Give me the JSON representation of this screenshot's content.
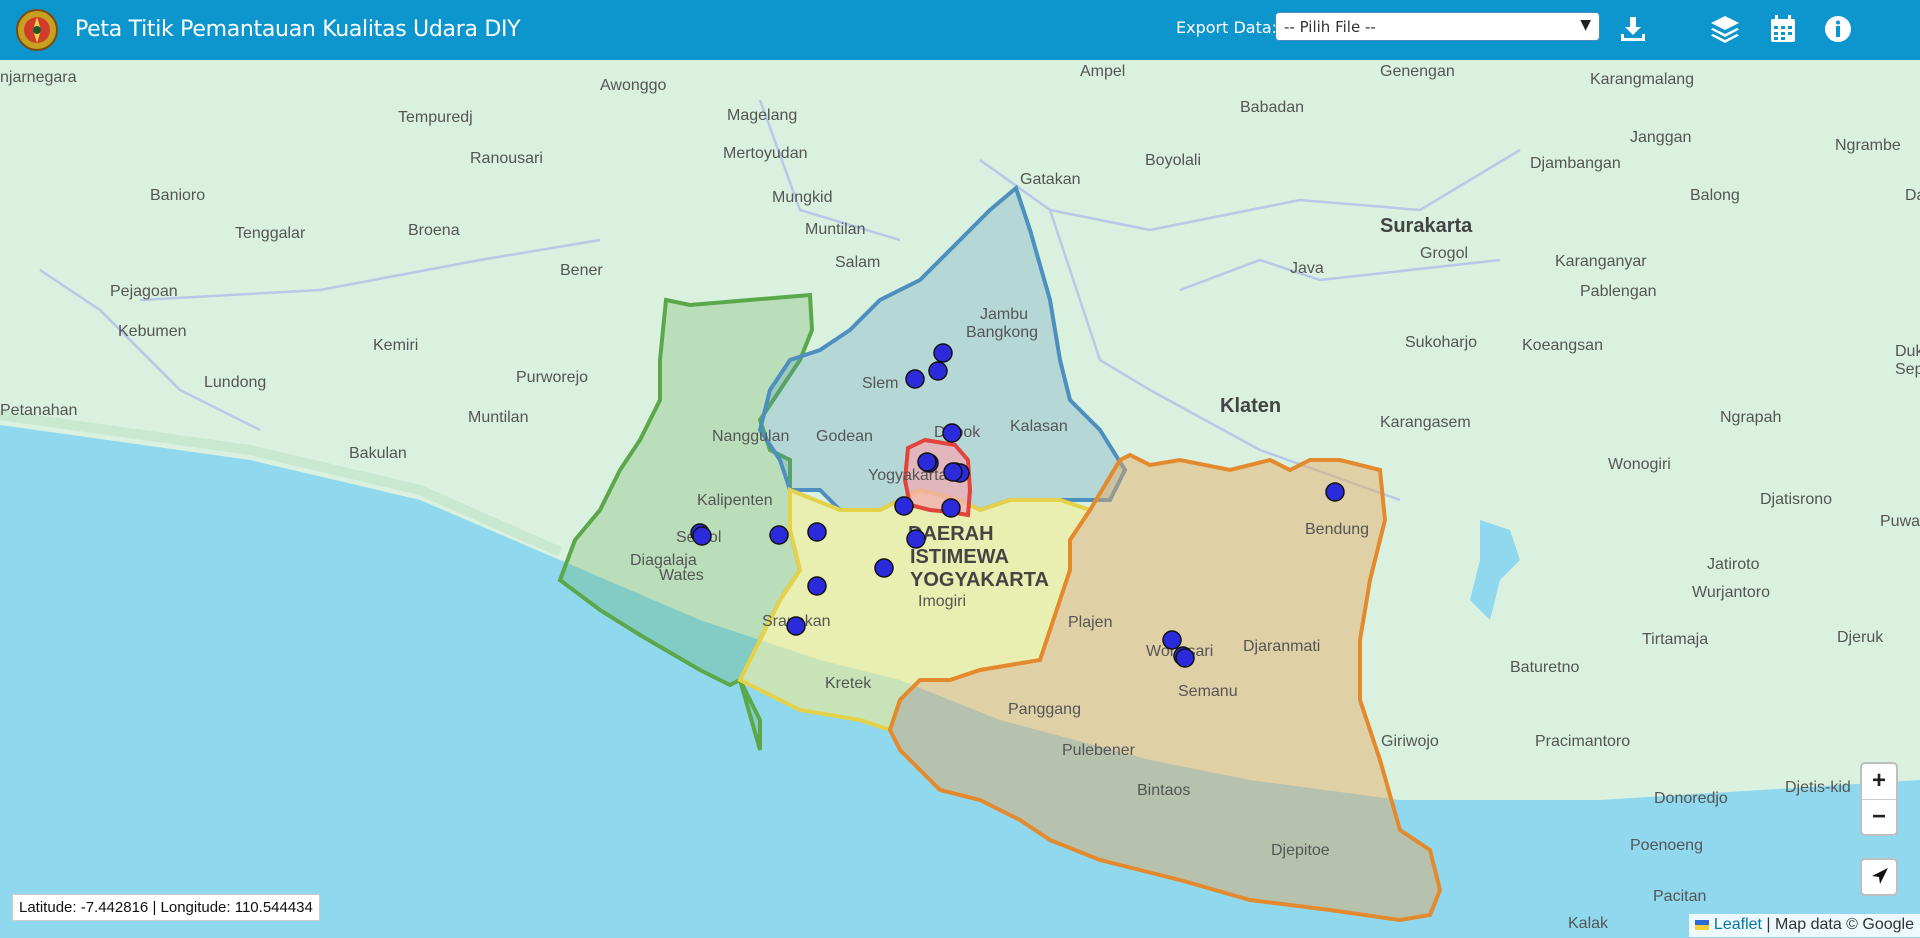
{
  "header": {
    "title": "Peta Titik Pemantauan Kualitas Udara DIY",
    "export_label": "Export Data:",
    "export_select_value": "-- Pilih File --",
    "background": "#0d96cd"
  },
  "toolbar": {
    "download_icon": "download-icon",
    "layers_icon": "layers-icon",
    "calendar_icon": "calendar-icon",
    "info_icon": "info-icon"
  },
  "map": {
    "coordinate_readout": "Latitude: -7.442816 | Longitude: 110.544434",
    "attribution_leaflet": "Leaflet",
    "attribution_rest": " | Map data © Google",
    "zoom_in": "+",
    "zoom_out": "−",
    "colors": {
      "sea": "#8fd8ee",
      "land": "#d6f0dc",
      "sleman": "#4d8fbf",
      "kulonprogo": "#5aa84a",
      "bantul": "#e6d24a",
      "gunungkidul": "#e38a2e",
      "kota": "#e0443c",
      "station": "#2b2bdc"
    },
    "place_labels": [
      "njarnegara",
      "Awonggo",
      "Ampel",
      "Genengan",
      "Karangmalang",
      "Tempuredj",
      "Magelang",
      "Babadan",
      "Ranousari",
      "Mertoyudan",
      "Boyolali",
      "Janggan",
      "Ngrambe",
      "Banioro",
      "Mungkid",
      "Gatakan",
      "Djambangan",
      "Balong",
      "Dac",
      "Tenggalar",
      "Broena",
      "Muntilan",
      "Surakarta",
      "Salam",
      "Grogol",
      "Karanganyar",
      "Pejagoan",
      "Bener",
      "Java",
      "Pablengan",
      "Jambu",
      "Bangkong",
      "Kebumen",
      "Kemiri",
      "Sukoharjo",
      "Koeangsan",
      "Duku",
      "Sepri",
      "Lundong",
      "Purworejo",
      "Slem",
      "Klaten",
      "Petanahan",
      "Muntilan",
      "Nanggulan",
      "Godean",
      "Depok",
      "Kalasan",
      "Karangasem",
      "Ngrapah",
      "Bakulan",
      "Wonogiri",
      "Yogyakarta",
      "Kalipenten",
      "Djatisrono",
      "Puwanto",
      "Bendung",
      "Sentol",
      "Diagalaja",
      "DAERAH",
      "ISTIMEWA",
      "YOGYAKARTA",
      "Wates",
      "Jatiroto",
      "Imogiri",
      "Wurjantoro",
      "Plajen",
      "Djaranmati",
      "Sranakan",
      "Tirtamaja",
      "Djeruk",
      "Wonosari",
      "Baturetno",
      "Kretek",
      "Semanu",
      "Panggang",
      "Pracimantoro",
      "Giriwojo",
      "Pulebener",
      "Djetis-kid",
      "Bintaos",
      "Donoredjo",
      "Poenoeng",
      "Djepitoe",
      "Pacitan",
      "Kalak"
    ],
    "stations_count": 23
  }
}
